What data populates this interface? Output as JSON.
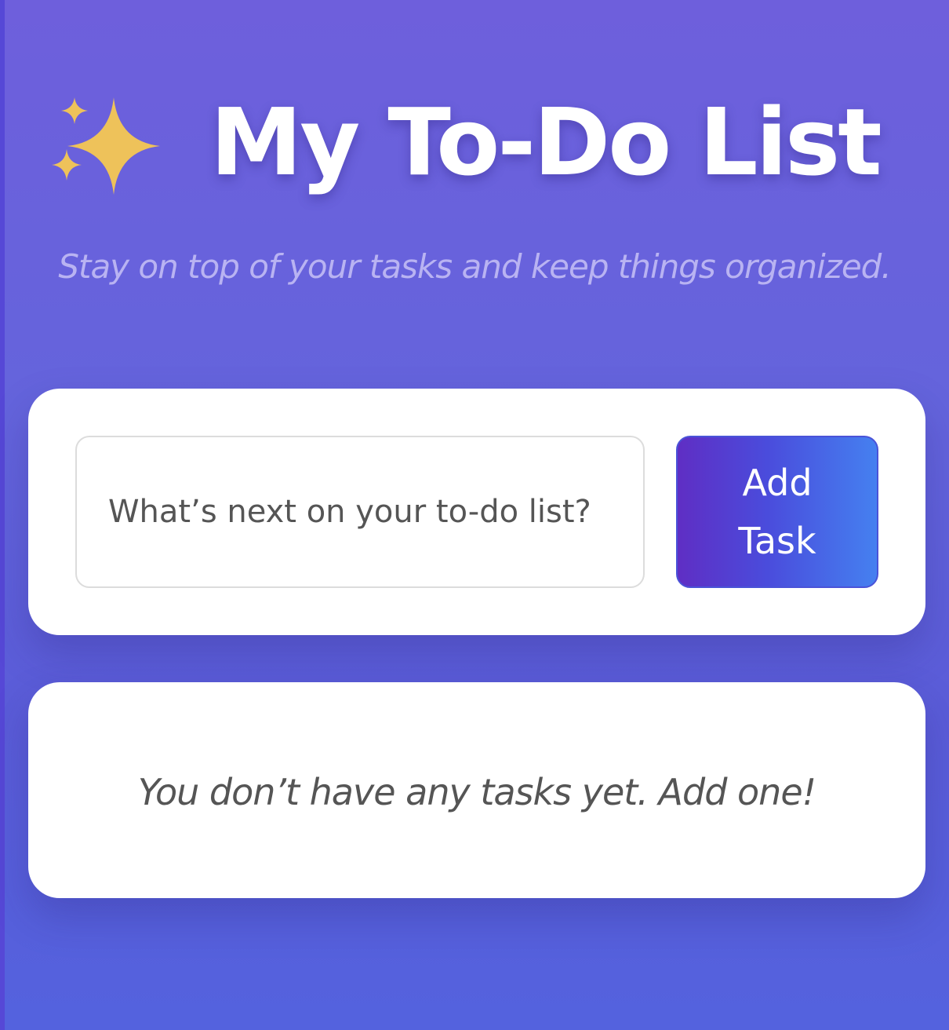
{
  "header": {
    "icon": "sparkles-icon",
    "title": "My To-Do List",
    "subtitle": "Stay on top of your tasks and keep things organized."
  },
  "form": {
    "input_placeholder": "What’s next on your to-do list?",
    "input_value": "",
    "add_button_label": "Add Task"
  },
  "task_list": {
    "items": [],
    "empty_message": "You don’t have any tasks yet. Add one!"
  },
  "colors": {
    "background_top": "#6e5fdc",
    "background_bottom": "#5462de",
    "sparkles": "#eec25a",
    "button_gradient_start": "#5f2ec4",
    "button_gradient_end": "#4580f0",
    "subtitle": "#b9b3f2"
  }
}
